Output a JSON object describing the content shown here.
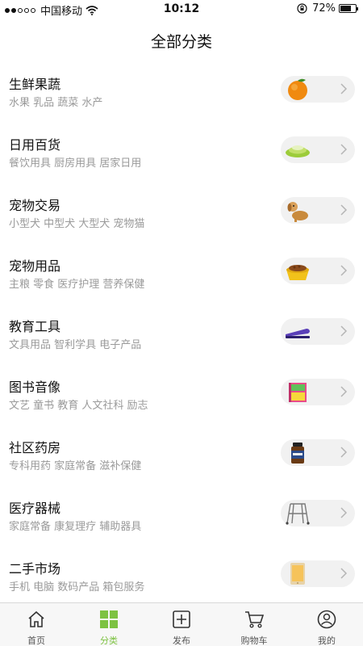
{
  "status_bar": {
    "carrier": "中国移动",
    "time": "10:12",
    "battery": "72%",
    "battery_level": 0.72
  },
  "header": {
    "title": "全部分类"
  },
  "categories": [
    {
      "title": "生鲜果蔬",
      "subtitle": "水果 乳品 蔬菜 水产",
      "icon": "orange-image"
    },
    {
      "title": "日用百货",
      "subtitle": "餐饮用具 厨房用具 居家日用",
      "icon": "plates-image"
    },
    {
      "title": "宠物交易",
      "subtitle": "小型犬 中型犬 大型犬 宠物猫",
      "icon": "dog-image"
    },
    {
      "title": "宠物用品",
      "subtitle": "主粮 零食 医疗护理 营养保健",
      "icon": "pet-bowl-image"
    },
    {
      "title": "教育工具",
      "subtitle": "文具用品 智利学具 电子产品",
      "icon": "stapler-image"
    },
    {
      "title": "图书音像",
      "subtitle": "文艺 童书 教育 人文社科 励志",
      "icon": "book-image"
    },
    {
      "title": "社区药房",
      "subtitle": "专科用药 家庭常备 滋补保健",
      "icon": "medicine-bottle-image"
    },
    {
      "title": "医疗器械",
      "subtitle": "家庭常备 康复理疗 辅助器具",
      "icon": "walker-image"
    },
    {
      "title": "二手市场",
      "subtitle": "手机 电脑 数码产品 箱包服务",
      "icon": "tablet-image"
    }
  ],
  "tabs": [
    {
      "label": "首页",
      "icon": "home-icon",
      "active": false
    },
    {
      "label": "分类",
      "icon": "category-grid-icon",
      "active": true
    },
    {
      "label": "发布",
      "icon": "publish-plus-icon",
      "active": false
    },
    {
      "label": "购物车",
      "icon": "cart-icon",
      "active": false
    },
    {
      "label": "我的",
      "icon": "profile-icon",
      "active": false
    }
  ],
  "colors": {
    "accent": "#7dc242",
    "subtitle": "#9a9a9a",
    "pill": "#f1f1f1"
  }
}
